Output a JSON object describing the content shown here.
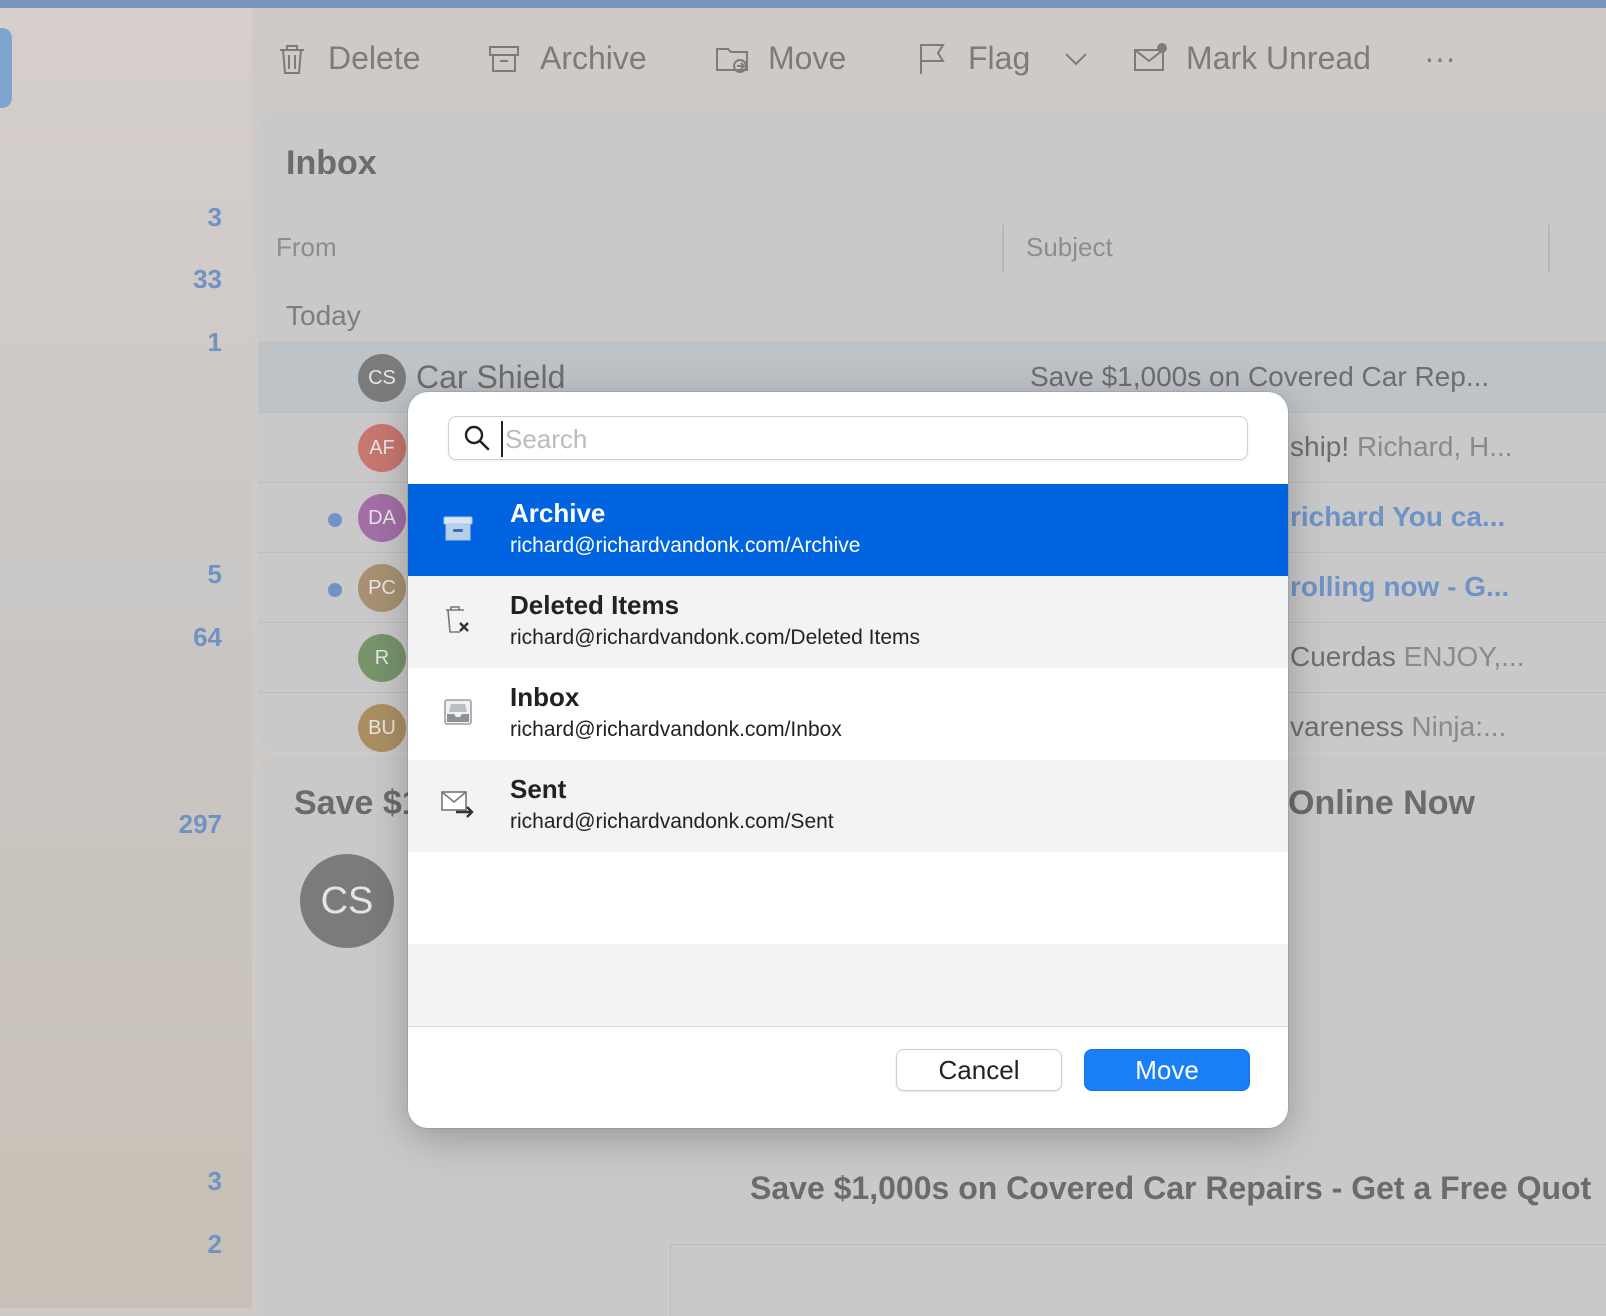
{
  "sidebar": {
    "counts": [
      {
        "value": "3",
        "top": 0
      },
      {
        "value": "33",
        "top": 0
      },
      {
        "value": "1",
        "top": 0
      },
      {
        "value": "5",
        "top": 0
      },
      {
        "value": "64",
        "top": 0
      },
      {
        "value": "297",
        "top": 0
      },
      {
        "value": "3",
        "top": 0
      },
      {
        "value": "2",
        "top": 0
      }
    ]
  },
  "toolbar": {
    "delete_label": "Delete",
    "archive_label": "Archive",
    "move_label": "Move",
    "flag_label": "Flag",
    "mark_unread_label": "Mark Unread",
    "more_label": "···"
  },
  "list": {
    "title": "Inbox",
    "col_from": "From",
    "col_subject": "Subject",
    "group_today": "Today",
    "rows": [
      {
        "initials": "CS",
        "avatar_color": "#7b7b7b",
        "from": "Car Shield",
        "subject": "Save $1,000s on Covered Car Rep...",
        "preview": "",
        "unread": false
      },
      {
        "initials": "AF",
        "avatar_color": "#c97670",
        "from": "",
        "subject": "ship!",
        "preview": "Richard, H...",
        "unread": false
      },
      {
        "initials": "DA",
        "avatar_color": "#a26fa6",
        "from": "",
        "subject": "richard You ca...",
        "preview": "",
        "unread": true
      },
      {
        "initials": "PC",
        "avatar_color": "#a89172",
        "from": "",
        "subject": "rolling now - G...",
        "preview": "",
        "unread": true
      },
      {
        "initials": "R",
        "avatar_color": "#77946b",
        "from": "",
        "subject": "Cuerdas",
        "preview": "ENJOY,...",
        "unread": false
      },
      {
        "initials": "BU",
        "avatar_color": "#ab8f63",
        "from": "",
        "subject": "vareness",
        "preview": "Ninja:...",
        "unread": false
      }
    ]
  },
  "reading": {
    "subject_head": "Save $1",
    "subject_tail": "Online Now",
    "avatar": "CS",
    "body_title": "Save $1,000s on Covered Car Repairs - Get a Free Quot"
  },
  "dialog": {
    "search_placeholder": "Search",
    "folders": [
      {
        "name": "Archive",
        "path": "richard@richardvandonk.com/Archive",
        "icon": "archive-box-icon",
        "selected": true
      },
      {
        "name": "Deleted Items",
        "path": "richard@richardvandonk.com/Deleted Items",
        "icon": "trash-icon",
        "selected": false
      },
      {
        "name": "Inbox",
        "path": "richard@richardvandonk.com/Inbox",
        "icon": "inbox-tray-icon",
        "selected": false
      },
      {
        "name": "Sent",
        "path": "richard@richardvandonk.com/Sent",
        "icon": "sent-envelope-icon",
        "selected": false
      }
    ],
    "cancel_label": "Cancel",
    "move_label": "Move"
  },
  "colors": {
    "selection_blue": "#0064e1",
    "move_button": "#1a7ef6",
    "unread_blue": "#6f93c6"
  }
}
